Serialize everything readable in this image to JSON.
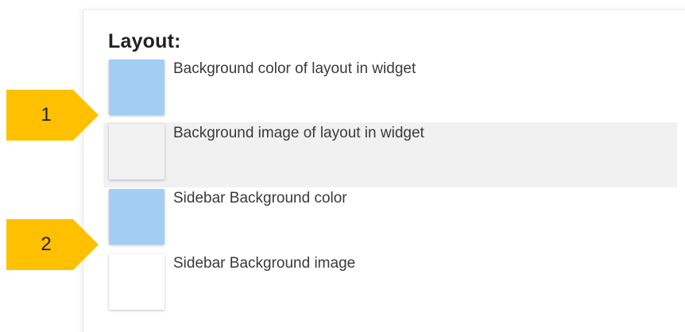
{
  "layout": {
    "title": "Layout:",
    "items": [
      {
        "label": "Background color of layout in widget",
        "swatch_color": "#a3cdf3",
        "highlighted": false
      },
      {
        "label": "Background image of layout in widget",
        "swatch_color": "#f2f2f2",
        "highlighted": true
      },
      {
        "label": "Sidebar Background color",
        "swatch_color": "#a3cdf3",
        "highlighted": false
      },
      {
        "label": "Sidebar Background image",
        "swatch_color": "#ffffff",
        "highlighted": false
      }
    ]
  },
  "callouts": [
    {
      "number": "1",
      "color": "#ffc000"
    },
    {
      "number": "2",
      "color": "#ffc000"
    }
  ],
  "colors": {
    "row_highlight": "#f1f1f1",
    "callout": "#ffc000"
  }
}
